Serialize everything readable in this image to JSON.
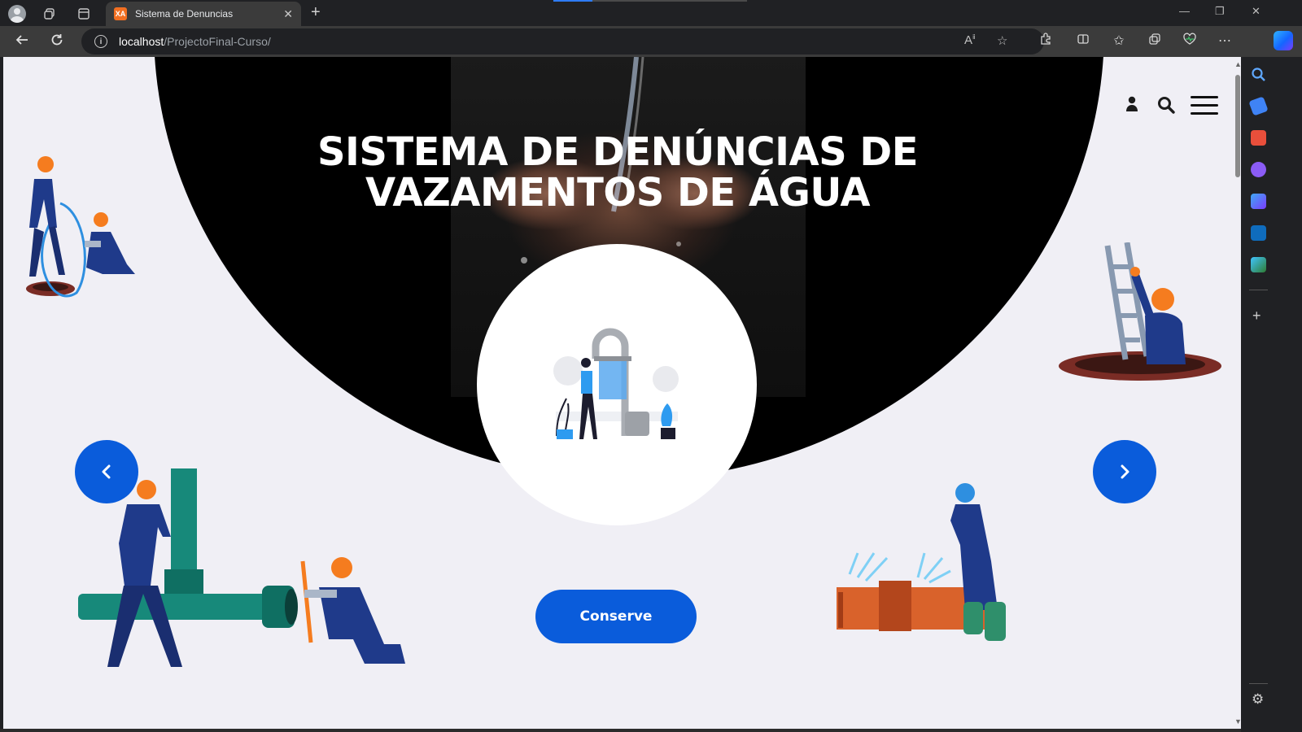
{
  "browser": {
    "tab_title": "Sistema de Denuncias",
    "tab_favicon_text": "XA",
    "url_host": "localhost",
    "url_path": "/ProjectoFinal-Curso/",
    "window_controls": {
      "minimize": "—",
      "restore": "❐",
      "close": "✕"
    }
  },
  "page": {
    "hero_title": "SISTEMA DE DENÚNCIAS DE VAZAMENTOS DE ÁGUA",
    "cta_label": "Conserve",
    "accent_color": "#0a5cdb"
  },
  "icons": {
    "header": [
      "user-icon",
      "search-icon",
      "menu-icon"
    ],
    "carousel": [
      "chevron-left-icon",
      "chevron-right-icon"
    ]
  }
}
